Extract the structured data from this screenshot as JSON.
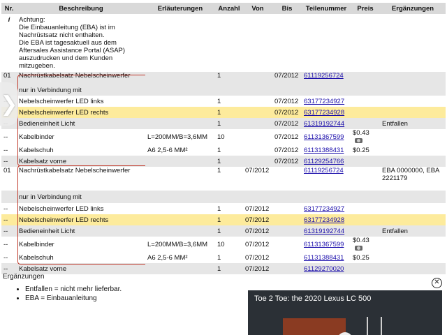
{
  "headers": {
    "nr": "Nr.",
    "beschreibung": "Beschreibung",
    "erlaeuterungen": "Erläuterungen",
    "anzahl": "Anzahl",
    "von": "Von",
    "bis": "Bis",
    "teilenummer": "Teilenummer",
    "preis": "Preis",
    "ergaenzungen": "Ergänzungen"
  },
  "note": {
    "nr": "i",
    "lines": [
      "Achtung:",
      "Die Einbauanleitung (EBA) ist im",
      "Nachrüstsatz nicht enthalten.",
      "Die EBA ist tagesaktuell aus dem",
      "Aftersales Assistance Portal (ASAP)",
      "auszudrucken und dem Kunden",
      "mitzugeben."
    ]
  },
  "rows": [
    {
      "nr": "01",
      "desc": "Nachrüstkabelsatz Nebelscheinwerfer",
      "erl": "",
      "anz": "1",
      "von": "",
      "bis": "07/2012",
      "tn": "61119256724",
      "preis": "",
      "erg": ""
    },
    {
      "nr": "",
      "desc": "nur in Verbindung mit",
      "erl": "",
      "anz": "",
      "von": "",
      "bis": "",
      "tn": "",
      "preis": "",
      "erg": ""
    },
    {
      "nr": "--",
      "desc": "Nebelscheinwerfer LED links",
      "erl": "",
      "anz": "1",
      "von": "",
      "bis": "07/2012",
      "tn": "63177234927",
      "preis": "",
      "erg": ""
    },
    {
      "nr": "--",
      "desc": "Nebelscheinwerfer LED rechts",
      "erl": "",
      "anz": "1",
      "von": "",
      "bis": "07/2012",
      "tn": "63177234928",
      "preis": "",
      "erg": ""
    },
    {
      "nr": "--",
      "desc": "Bedieneinheit Licht",
      "erl": "",
      "anz": "1",
      "von": "",
      "bis": "07/2012",
      "tn": "61319192744",
      "preis": "",
      "erg": "Entfallen"
    },
    {
      "nr": "--",
      "desc": "Kabelbinder",
      "erl": "L=200MM/B=3,6MM",
      "anz": "10",
      "von": "",
      "bis": "07/2012",
      "tn": "61131367599",
      "preis": "$0.43",
      "erg": ""
    },
    {
      "nr": "--",
      "desc": "Kabelschuh",
      "erl": "A6 2,5-6 MM²",
      "anz": "1",
      "von": "",
      "bis": "07/2012",
      "tn": "61131388431",
      "preis": "$0.25",
      "erg": ""
    },
    {
      "nr": "--",
      "desc": "Kabelsatz vorne",
      "erl": "",
      "anz": "1",
      "von": "",
      "bis": "07/2012",
      "tn": "61129254766",
      "preis": "",
      "erg": ""
    },
    {
      "nr": "01",
      "desc": "Nachrüstkabelsatz Nebelscheinwerfer",
      "erl": "",
      "anz": "1",
      "von": "07/2012",
      "bis": "",
      "tn": "61119256724",
      "preis": "",
      "erg": "EBA 0000000, EBA 2221179"
    },
    {
      "nr": "",
      "desc": "nur in Verbindung mit",
      "erl": "",
      "anz": "",
      "von": "",
      "bis": "",
      "tn": "",
      "preis": "",
      "erg": ""
    },
    {
      "nr": "--",
      "desc": "Nebelscheinwerfer LED links",
      "erl": "",
      "anz": "1",
      "von": "07/2012",
      "bis": "",
      "tn": "63177234927",
      "preis": "",
      "erg": ""
    },
    {
      "nr": "--",
      "desc": "Nebelscheinwerfer LED rechts",
      "erl": "",
      "anz": "1",
      "von": "07/2012",
      "bis": "",
      "tn": "63177234928",
      "preis": "",
      "erg": ""
    },
    {
      "nr": "--",
      "desc": "Bedieneinheit Licht",
      "erl": "",
      "anz": "1",
      "von": "07/2012",
      "bis": "",
      "tn": "61319192744",
      "preis": "",
      "erg": "Entfallen"
    },
    {
      "nr": "--",
      "desc": "Kabelbinder",
      "erl": "L=200MM/B=3,6MM",
      "anz": "10",
      "von": "07/2012",
      "bis": "",
      "tn": "61131367599",
      "preis": "$0.43",
      "erg": ""
    },
    {
      "nr": "--",
      "desc": "Kabelschuh",
      "erl": "A6 2,5-6 MM²",
      "anz": "1",
      "von": "07/2012",
      "bis": "",
      "tn": "61131388431",
      "preis": "$0.25",
      "erg": ""
    },
    {
      "nr": "--",
      "desc": "Kabelsatz vorne",
      "erl": "",
      "anz": "1",
      "von": "07/2012",
      "bis": "",
      "tn": "61129270020",
      "preis": "",
      "erg": ""
    }
  ],
  "legend": {
    "title": "Ergänzungen",
    "items": [
      "Entfallen = nicht mehr lieferbar.",
      "EBA = Einbauanleitung"
    ]
  },
  "video": {
    "title": "Toe 2 Toe: the 2020 Lexus LC 500"
  },
  "icons": {
    "price_camera": "camera-icon",
    "side_arrow": "chevron-right-icon",
    "close": "close-icon"
  },
  "colors": {
    "header_bg": "#d9d9d9",
    "shade_bg": "#e6e6e6",
    "highlight_bg": "#fdeb9c",
    "bracket": "#c0392b",
    "link": "#1a0dab"
  }
}
